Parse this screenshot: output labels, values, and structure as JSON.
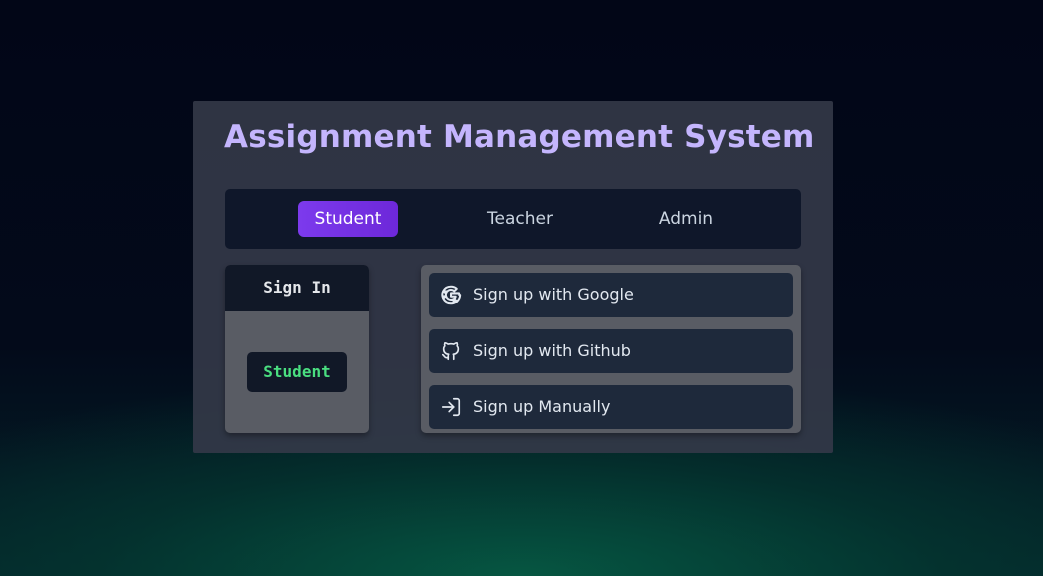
{
  "app": {
    "title": "Assignment Management System"
  },
  "tabs": [
    {
      "label": "Student",
      "active": true
    },
    {
      "label": "Teacher",
      "active": false
    },
    {
      "label": "Admin",
      "active": false
    }
  ],
  "signin": {
    "header": "Sign In",
    "role": "Student"
  },
  "signup": {
    "buttons": [
      {
        "label": "Sign up with Google",
        "icon": "google-icon"
      },
      {
        "label": "Sign up with Github",
        "icon": "github-icon"
      },
      {
        "label": "Sign up Manually",
        "icon": "login-arrow-icon"
      }
    ]
  },
  "colors": {
    "title": "#c4b5fd",
    "active_tab": "#7c3aed",
    "role_text": "#4ade80",
    "panel_dark": "#111827",
    "button_bg": "#1e293b"
  }
}
